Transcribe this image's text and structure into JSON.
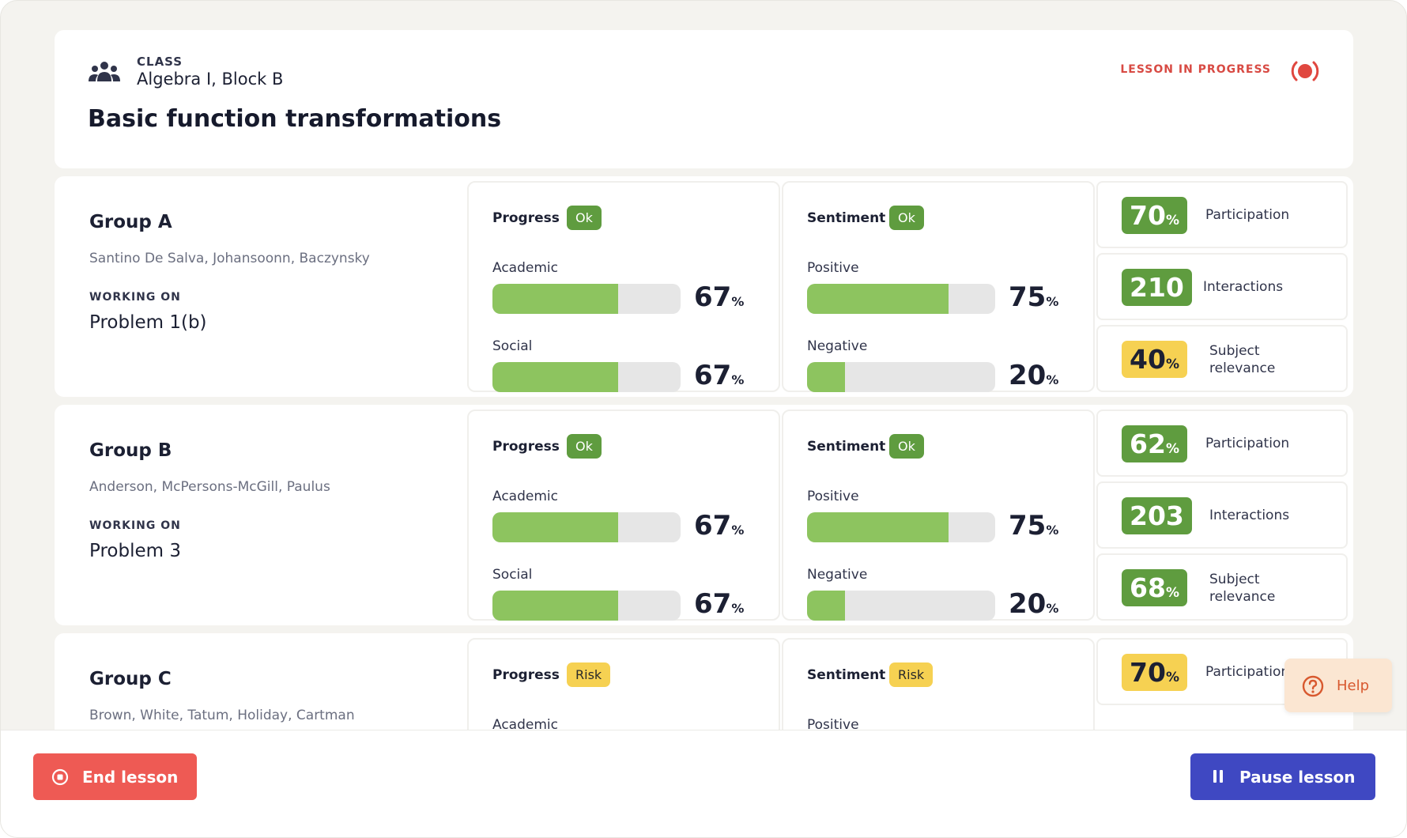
{
  "header": {
    "class_label": "CLASS",
    "class_name": "Algebra I, Block B",
    "lesson_title": "Basic function transformations",
    "status": "LESSON IN PROGRESS",
    "icons": {
      "class": "group-people-icon",
      "status": "live-record-icon"
    }
  },
  "colors": {
    "ok_badge": "#5f9c3f",
    "risk_badge": "#f6d152",
    "bar_fill": "#8dc45f",
    "bar_track": "#e6e6e6",
    "end_button": "#ee5a54",
    "pause_button": "#3f48c2",
    "status_red": "#d84a43"
  },
  "labels": {
    "working_on": "WORKING ON",
    "progress": "Progress",
    "sentiment": "Sentiment",
    "academic": "Academic",
    "social": "Social",
    "positive": "Positive",
    "negative": "Negative",
    "participation": "Participation",
    "interactions": "Interactions",
    "subject_relevance": "Subject relevance",
    "percent": "%"
  },
  "groups": [
    {
      "name": "Group A",
      "members": "Santino De Salva,  Johansoonn,  Baczynsky",
      "working_on": "Problem 1(b)",
      "progress_status": "Ok",
      "sentiment_status": "Ok",
      "academic": 67,
      "social": 67,
      "positive": 75,
      "negative": 20,
      "participation": "70",
      "interactions": "210",
      "subject_relevance": "40"
    },
    {
      "name": "Group B",
      "members": "Anderson,  McPersons-McGill,  Paulus",
      "working_on": "Problem 3",
      "progress_status": "Ok",
      "sentiment_status": "Ok",
      "academic": 67,
      "social": 67,
      "positive": 75,
      "negative": 20,
      "participation": "62",
      "interactions": "203",
      "subject_relevance": "68"
    },
    {
      "name": "Group C",
      "members": "Brown,  White,  Tatum,  Holiday,  Cartman",
      "progress_status": "Risk",
      "sentiment_status": "Risk",
      "participation": "70"
    }
  ],
  "help": {
    "label": "Help",
    "icon": "question-circle-icon"
  },
  "footer": {
    "end_label": "End lesson",
    "end_icon": "stop-circle-icon",
    "pause_label": "Pause lesson",
    "pause_icon": "pause-icon"
  }
}
